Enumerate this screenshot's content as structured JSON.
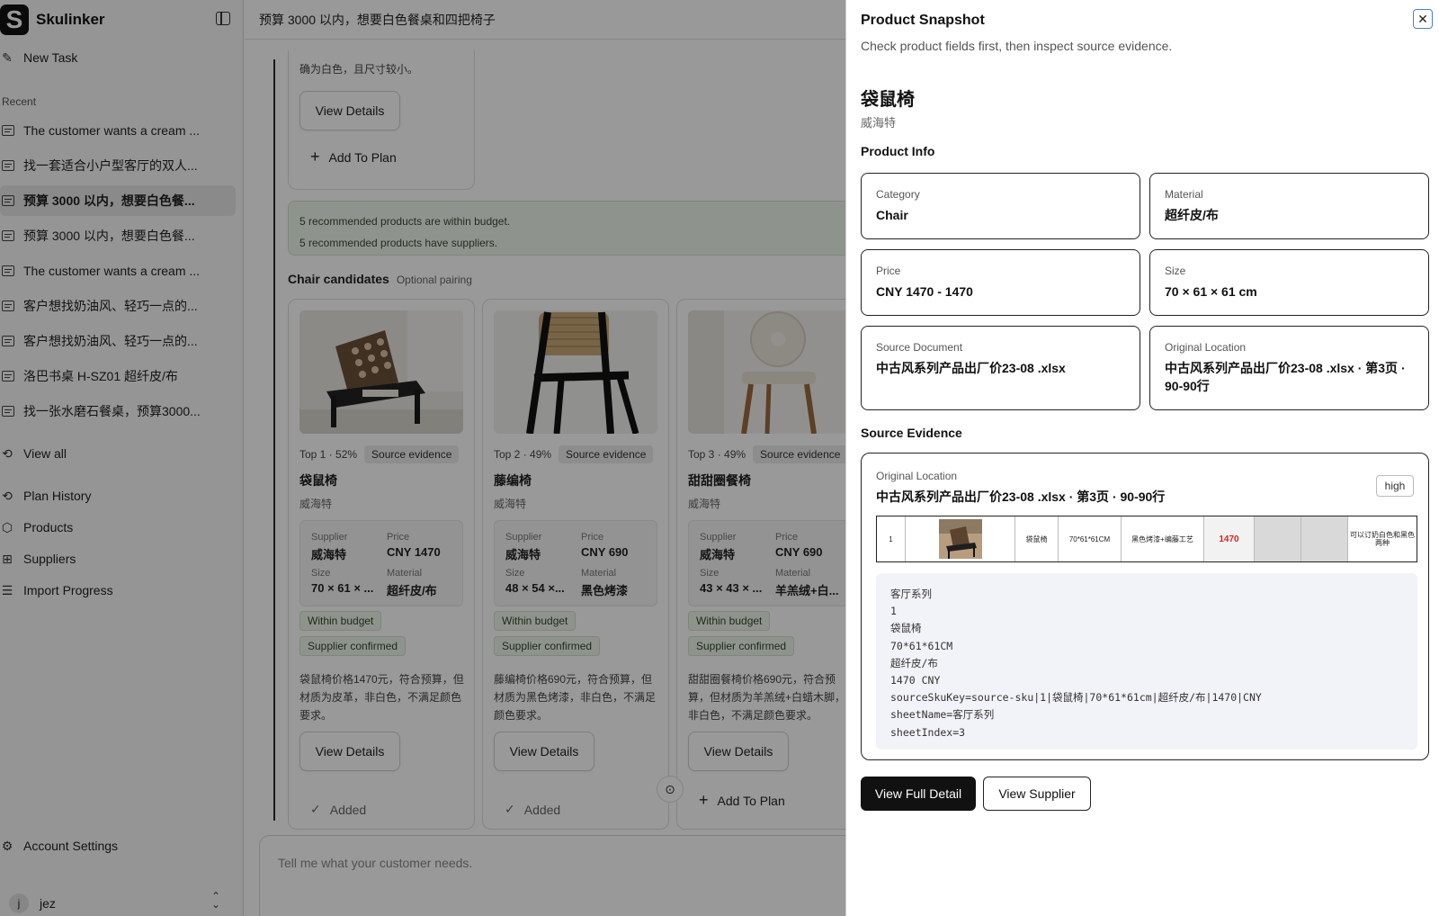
{
  "app": {
    "name": "Skulinker",
    "logo_letter": "S"
  },
  "sidebar": {
    "new_task": "New Task",
    "recent_label": "Recent",
    "recent": [
      "The customer wants a cream ...",
      "找一套适合小户型客厅的双人...",
      "预算 3000 以内，想要白色餐...",
      "预算 3000 以内，想要白色餐...",
      "The customer wants a cream ...",
      "客户想找奶油风、轻巧一点的...",
      "客户想找奶油风、轻巧一点的...",
      "洛巴书桌 H-SZ01 超纤皮/布",
      "找一张水磨石餐桌，预算3000..."
    ],
    "active_index": 2,
    "view_all": "View all",
    "nav": [
      "Plan History",
      "Products",
      "Suppliers",
      "Import Progress"
    ],
    "account_settings": "Account Settings",
    "user": {
      "initial": "j",
      "name": "jez"
    }
  },
  "main": {
    "title": "预算 3000 以内，想要白色餐桌和四把椅子",
    "prev_card": {
      "text": "确为白色，且尺寸较小。",
      "view_details": "View Details",
      "add_to_plan": "Add To Plan"
    },
    "notice": [
      "5 recommended products are within budget.",
      "5 recommended products have suppliers."
    ],
    "section_title": "Chair candidates",
    "section_sub": "Optional pairing",
    "labels": {
      "supplier": "Supplier",
      "price": "Price",
      "size": "Size",
      "material": "Material",
      "source_evidence": "Source evidence",
      "view_details": "View Details"
    },
    "cards": [
      {
        "rank": "Top 1 · 52%",
        "name": "袋鼠椅",
        "brand": "威海特",
        "supplier": "威海特",
        "price": "CNY 1470",
        "size": "70 × 61 × ...",
        "material": "超纤皮/布",
        "badges": [
          "Within budget",
          "Supplier confirmed"
        ],
        "reason": "袋鼠椅价格1470元，符合预算，但材质为皮革，非白色，不满足颜色要求。",
        "action": "Added"
      },
      {
        "rank": "Top 2 · 49%",
        "name": "藤编椅",
        "brand": "威海特",
        "supplier": "威海特",
        "price": "CNY 690",
        "size": "48 × 54 ×...",
        "material": "黑色烤漆",
        "badges": [
          "Within budget",
          "Supplier confirmed"
        ],
        "reason": "藤编椅价格690元，符合预算，但材质为黑色烤漆，非白色，不满足颜色要求。",
        "action": "Added"
      },
      {
        "rank": "Top 3 · 49%",
        "name": "甜甜圈餐椅",
        "brand": "威海特",
        "supplier": "威海特",
        "price": "CNY 690",
        "size": "43 × 43 × ...",
        "material": "羊羔绒+白...",
        "badges": [
          "Within budget",
          "Supplier confirmed"
        ],
        "reason": "甜甜圈餐椅价格690元，符合预算，但材质为羊羔绒+白蜡木脚，非白色，不满足颜色要求。",
        "action": "Add To Plan"
      }
    ],
    "composer_placeholder": "Tell me what your customer needs."
  },
  "drawer": {
    "title": "Product Snapshot",
    "subtitle": "Check product fields first, then inspect source evidence.",
    "product_name": "袋鼠椅",
    "brand": "威海特",
    "product_info_title": "Product Info",
    "fields": [
      {
        "label": "Category",
        "value": "Chair"
      },
      {
        "label": "Material",
        "value": "超纤皮/布"
      },
      {
        "label": "Price",
        "value": "CNY 1470 - 1470"
      },
      {
        "label": "Size",
        "value": "70 × 61 × 61 cm"
      },
      {
        "label": "Source Document",
        "value": "中古风系列产品出厂价23-08 .xlsx"
      },
      {
        "label": "Original Location",
        "value": "中古风系列产品出厂价23-08 .xlsx · 第3页 · 90-90行"
      }
    ],
    "evidence_title": "Source Evidence",
    "evidence": {
      "label": "Original Location",
      "location": "中古风系列产品出厂价23-08 .xlsx · 第3页 · 90-90行",
      "confidence": "high",
      "sheet_cells": [
        "1",
        "",
        "袋鼠椅",
        "70*61*61CM",
        "黑色烤漆+编藤工艺",
        "1470",
        "",
        "",
        "可以订奶白色和黑色两种"
      ],
      "raw_lines": [
        "客厅系列",
        "1",
        "袋鼠椅",
        "70*61*61CM",
        "超纤皮/布",
        "1470 CNY",
        "sourceSkuKey=source-sku|1|袋鼠椅|70*61*61cm|超纤皮/布|1470|CNY",
        "sheetName=客厅系列",
        "sheetIndex=3"
      ]
    },
    "view_full_detail": "View Full Detail",
    "view_supplier": "View Supplier"
  }
}
